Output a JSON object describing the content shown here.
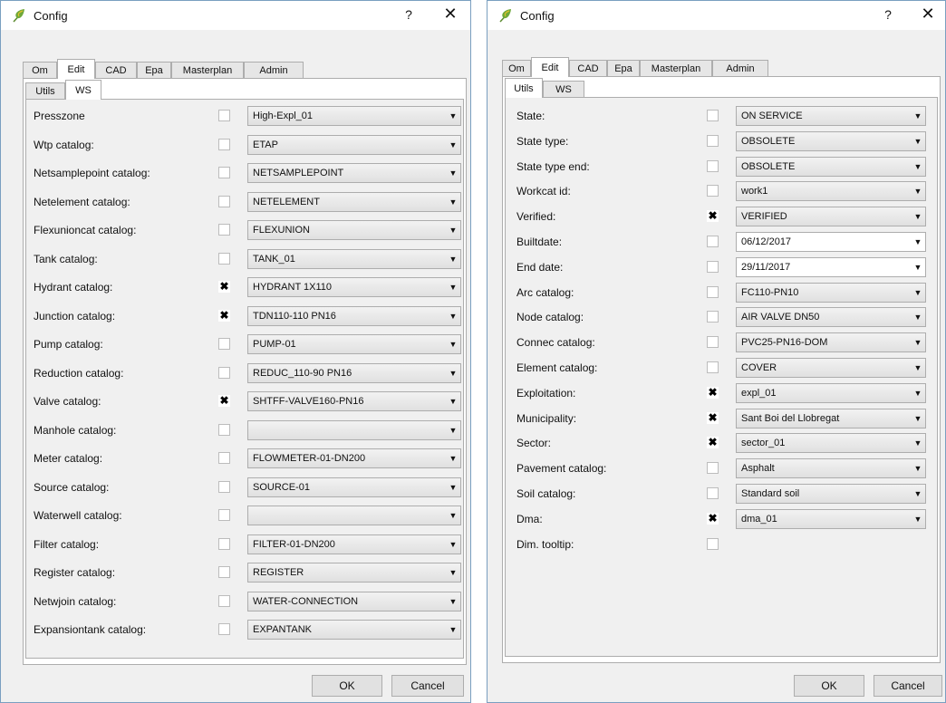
{
  "left": {
    "title": "Config",
    "help_label": "?",
    "close_label": "✕",
    "tabs": [
      "Om",
      "Edit",
      "CAD",
      "Epa",
      "Masterplan",
      "Admin"
    ],
    "subtabs": [
      "Utils",
      "WS"
    ],
    "fields": [
      {
        "label": "Presszone",
        "checked": false,
        "value": "High-Expl_01"
      },
      {
        "label": "Wtp catalog:",
        "checked": false,
        "value": "ETAP"
      },
      {
        "label": "Netsamplepoint catalog:",
        "checked": false,
        "value": "NETSAMPLEPOINT"
      },
      {
        "label": "Netelement catalog:",
        "checked": false,
        "value": "NETELEMENT"
      },
      {
        "label": "Flexunioncat catalog:",
        "checked": false,
        "value": "FLEXUNION"
      },
      {
        "label": "Tank catalog:",
        "checked": false,
        "value": "TANK_01"
      },
      {
        "label": "Hydrant catalog:",
        "checked": true,
        "value": "HYDRANT 1X110"
      },
      {
        "label": "Junction catalog:",
        "checked": true,
        "value": "TDN110-110 PN16"
      },
      {
        "label": "Pump catalog:",
        "checked": false,
        "value": "PUMP-01"
      },
      {
        "label": "Reduction catalog:",
        "checked": false,
        "value": "REDUC_110-90 PN16"
      },
      {
        "label": "Valve catalog:",
        "checked": true,
        "value": "SHTFF-VALVE160-PN16"
      },
      {
        "label": "Manhole catalog:",
        "checked": false,
        "value": ""
      },
      {
        "label": "Meter catalog:",
        "checked": false,
        "value": "FLOWMETER-01-DN200"
      },
      {
        "label": "Source catalog:",
        "checked": false,
        "value": "SOURCE-01"
      },
      {
        "label": "Waterwell catalog:",
        "checked": false,
        "value": ""
      },
      {
        "label": "Filter catalog:",
        "checked": false,
        "value": "FILTER-01-DN200"
      },
      {
        "label": "Register catalog:",
        "checked": false,
        "value": "REGISTER"
      },
      {
        "label": "Netwjoin catalog:",
        "checked": false,
        "value": "WATER-CONNECTION"
      },
      {
        "label": "Expansiontank catalog:",
        "checked": false,
        "value": "EXPANTANK"
      }
    ],
    "ok_label": "OK",
    "cancel_label": "Cancel"
  },
  "right": {
    "title": "Config",
    "help_label": "?",
    "close_label": "✕",
    "tabs": [
      "Om",
      "Edit",
      "CAD",
      "Epa",
      "Masterplan",
      "Admin"
    ],
    "subtabs": [
      "Utils",
      "WS"
    ],
    "fields": [
      {
        "label": "State:",
        "checked": false,
        "value": "ON SERVICE"
      },
      {
        "label": "State type:",
        "checked": false,
        "value": "OBSOLETE"
      },
      {
        "label": "State type end:",
        "checked": false,
        "value": "OBSOLETE"
      },
      {
        "label": "Workcat id:",
        "checked": false,
        "value": "work1"
      },
      {
        "label": "Verified:",
        "checked": true,
        "value": "VERIFIED"
      },
      {
        "label": "Builtdate:",
        "checked": false,
        "value": "06/12/2017",
        "editable": true
      },
      {
        "label": "End date:",
        "checked": false,
        "value": "29/11/2017",
        "editable": true
      },
      {
        "label": "Arc catalog:",
        "checked": false,
        "value": "FC110-PN10"
      },
      {
        "label": "Node catalog:",
        "checked": false,
        "value": "AIR VALVE DN50"
      },
      {
        "label": "Connec catalog:",
        "checked": false,
        "value": "PVC25-PN16-DOM"
      },
      {
        "label": "Element catalog:",
        "checked": false,
        "value": "COVER"
      },
      {
        "label": "Exploitation:",
        "checked": true,
        "value": "expl_01"
      },
      {
        "label": "Municipality:",
        "checked": true,
        "value": "Sant Boi del Llobregat"
      },
      {
        "label": "Sector:",
        "checked": true,
        "value": "sector_01"
      },
      {
        "label": "Pavement catalog:",
        "checked": false,
        "value": "Asphalt"
      },
      {
        "label": "Soil catalog:",
        "checked": false,
        "value": "Standard soil"
      },
      {
        "label": "Dma:",
        "checked": true,
        "value": "dma_01"
      },
      {
        "label": "Dim. tooltip:",
        "checked": false,
        "value": null
      }
    ],
    "ok_label": "OK",
    "cancel_label": "Cancel"
  },
  "icons": {
    "app": "qgis-leaf-icon",
    "dropdown": "chevron-down-icon",
    "check": "check-x-icon"
  },
  "colors": {
    "window_border": "#7a9fc0",
    "dialog_bg": "#f0f0f0",
    "leaf_green": "#6fa83a",
    "leaf_yellow": "#e0c02a"
  }
}
